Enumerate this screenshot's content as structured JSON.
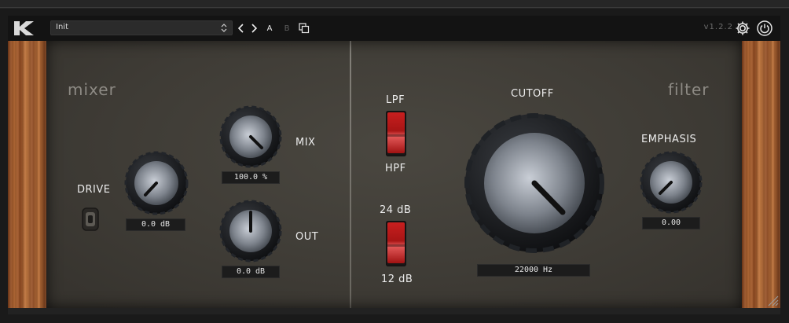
{
  "toolbar": {
    "preset_name": "Init",
    "ab_a": "A",
    "ab_b": "B",
    "version": "v1.2.2"
  },
  "mixer": {
    "title": "mixer",
    "drive": {
      "label": "DRIVE",
      "value": "0.0 dB"
    },
    "mix": {
      "label": "MIX",
      "value": "100.0 %"
    },
    "out": {
      "label": "OUT",
      "value": "0.0 dB"
    }
  },
  "filter": {
    "title": "filter",
    "lpf_label": "LPF",
    "hpf_label": "HPF",
    "slope_top": "24 dB",
    "slope_bottom": "12 dB",
    "cutoff": {
      "label": "CUTOFF",
      "value": "22000 Hz"
    },
    "emphasis": {
      "label": "EMPHASIS",
      "value": "0.00"
    }
  },
  "colors": {
    "accent_red": "#c81f1f",
    "wood": "#b46a36",
    "panel": "#45423b"
  }
}
